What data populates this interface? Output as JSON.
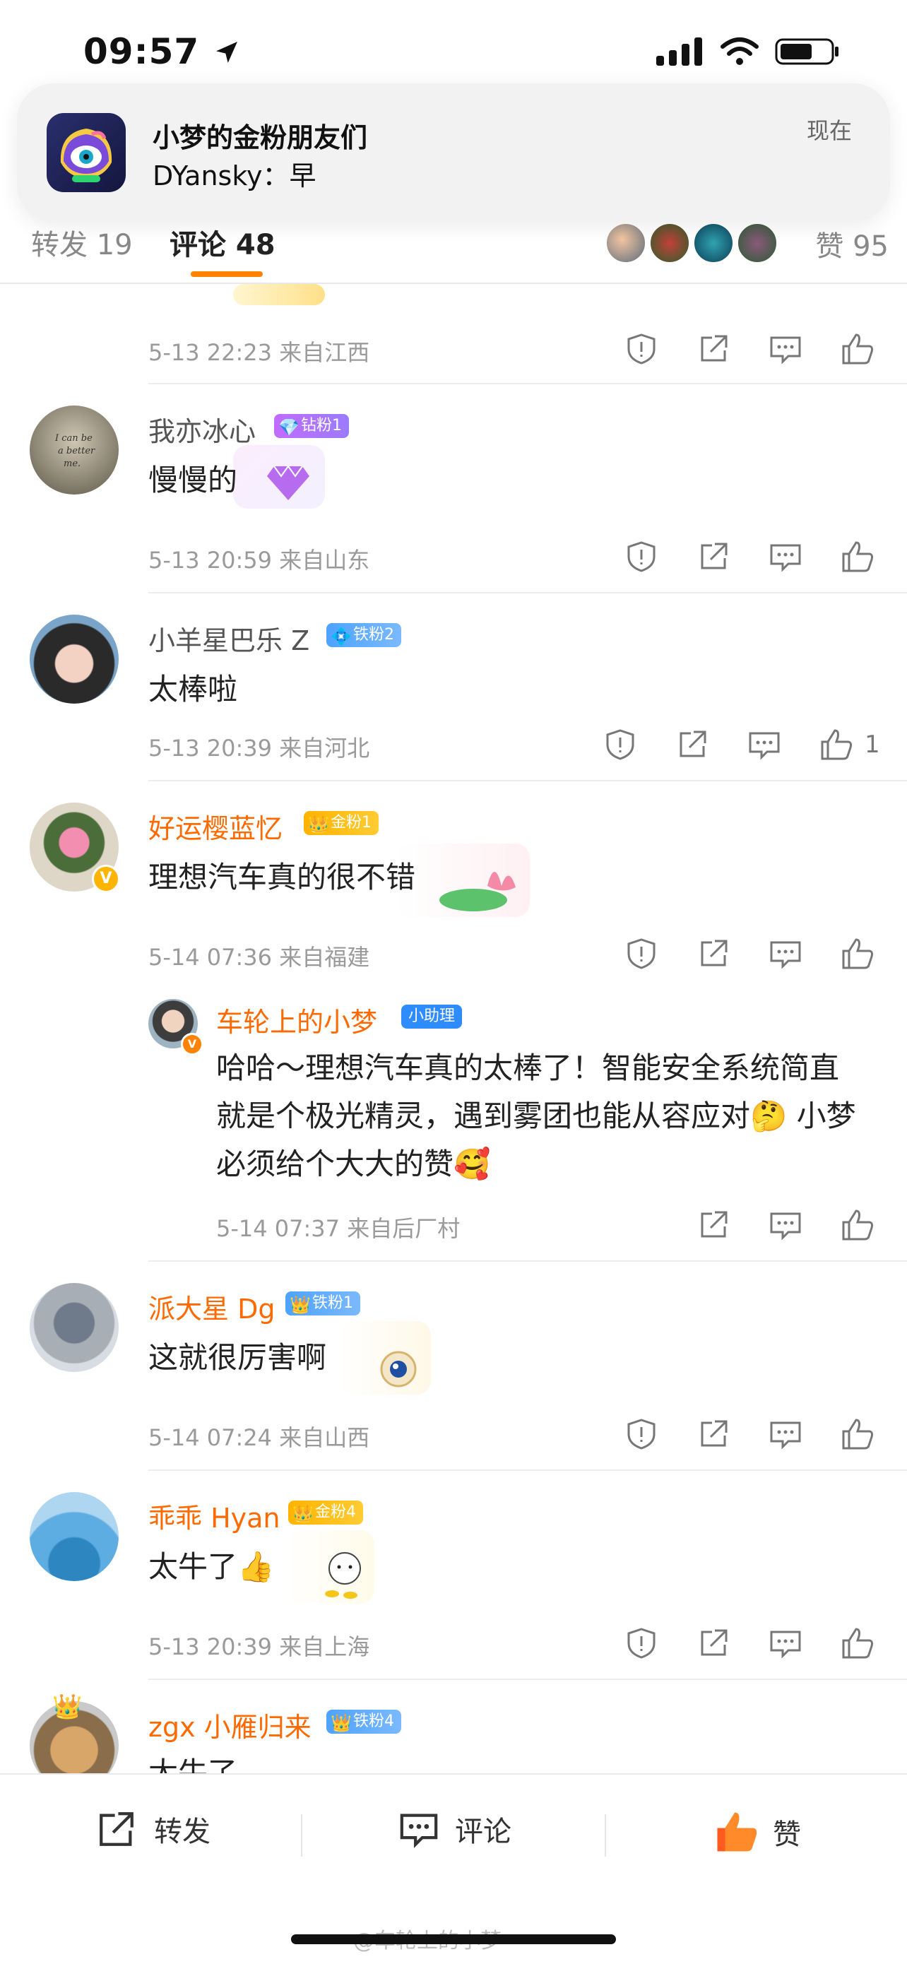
{
  "status_bar": {
    "time": "09:57"
  },
  "notification": {
    "title": "小梦的金粉朋友们",
    "body": "DYansky：早",
    "time": "现在"
  },
  "tabs": {
    "repost": "转发 19",
    "comments": "评论 48",
    "likes": "赞 95"
  },
  "comments": [
    {
      "meta": "5-13 22:23 来自江西"
    },
    {
      "username": "我亦冰心",
      "badge": "钻粉1",
      "text": "慢慢的",
      "meta": "5-13 20:59 来自山东"
    },
    {
      "username": "小羊星巴乐 Z",
      "badge": "铁粉2",
      "text": "太棒啦",
      "meta": "5-13 20:39 来自河北",
      "likes": "1"
    },
    {
      "username": "好运樱蓝忆",
      "badge": "金粉1",
      "text": "理想汽车真的很不错",
      "meta": "5-14 07:36 来自福建",
      "reply": {
        "username": "车轮上的小梦",
        "badge": "小助理",
        "text": "哈哈～理想汽车真的太棒了！智能安全系统简直就是个极光精灵，遇到雾团也能从容应对🤔 小梦必须给个大大的赞🥰",
        "meta": "5-14 07:37 来自后厂村"
      }
    },
    {
      "username": "派大星 Dg",
      "badge": "铁粉1",
      "text": "这就很厉害啊",
      "meta": "5-14 07:24 来自山西"
    },
    {
      "username": "乖乖 Hyan",
      "badge": "金粉4",
      "text": "太牛了👍",
      "meta": "5-13 20:39 来自上海"
    },
    {
      "username": "zgx 小雁归来",
      "badge": "铁粉4",
      "text": "太牛了"
    }
  ],
  "bottom_bar": {
    "repost": "转发",
    "comment": "评论",
    "like": "赞"
  },
  "watermark": "@车轮上的小梦"
}
